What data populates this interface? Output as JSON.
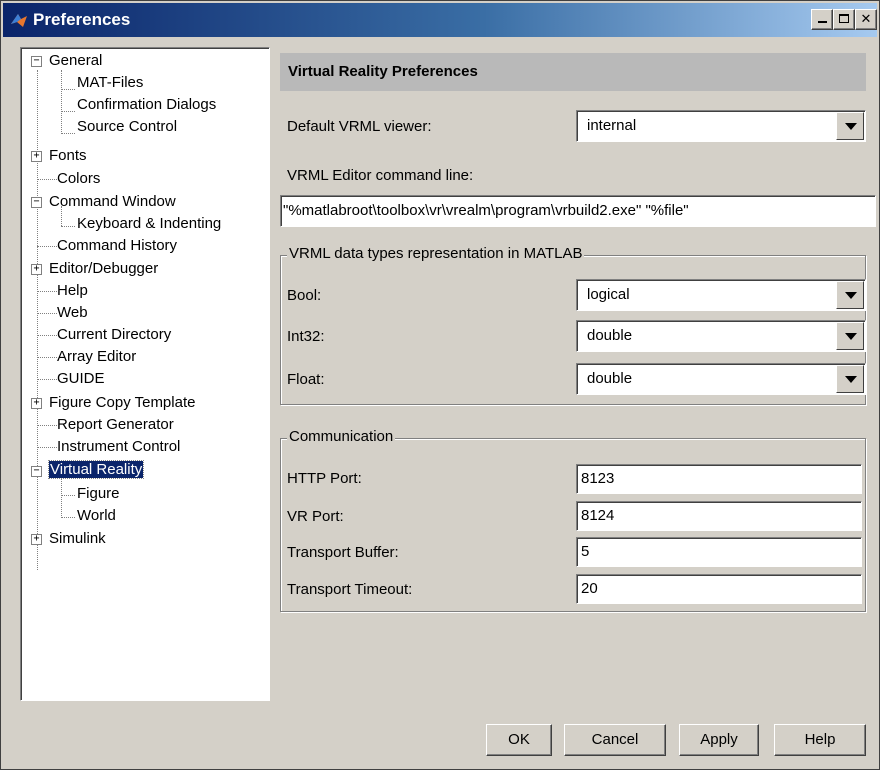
{
  "window": {
    "title": "Preferences"
  },
  "tree": {
    "items": [
      {
        "label": "General",
        "expander": "−"
      },
      {
        "label": "MAT-Files"
      },
      {
        "label": "Confirmation Dialogs"
      },
      {
        "label": "Source Control"
      },
      {
        "label": "Fonts",
        "expander": "+"
      },
      {
        "label": "Colors"
      },
      {
        "label": "Command Window",
        "expander": "−"
      },
      {
        "label": "Keyboard & Indenting"
      },
      {
        "label": "Command History"
      },
      {
        "label": "Editor/Debugger",
        "expander": "+"
      },
      {
        "label": "Help"
      },
      {
        "label": "Web"
      },
      {
        "label": "Current Directory"
      },
      {
        "label": "Array Editor"
      },
      {
        "label": "GUIDE"
      },
      {
        "label": "Figure Copy Template",
        "expander": "+"
      },
      {
        "label": "Report Generator"
      },
      {
        "label": "Instrument Control"
      },
      {
        "label": "Virtual Reality",
        "expander": "−",
        "selected": true
      },
      {
        "label": "Figure"
      },
      {
        "label": "World"
      },
      {
        "label": "Simulink",
        "expander": "+"
      }
    ]
  },
  "panel": {
    "header": "Virtual Reality Preferences",
    "viewer_label": "Default VRML viewer:",
    "viewer_value": "internal",
    "editor_label": "VRML Editor command line:",
    "editor_value": "\"%matlabroot\\toolbox\\vr\\vrealm\\program\\vrbuild2.exe\" \"%file\"",
    "types_group": {
      "title": "VRML data types representation in MATLAB",
      "bool_label": "Bool:",
      "bool_value": "logical",
      "int32_label": "Int32:",
      "int32_value": "double",
      "float_label": "Float:",
      "float_value": "double"
    },
    "comm_group": {
      "title": "Communication",
      "http_label": "HTTP Port:",
      "http_value": "8123",
      "vr_label": "VR Port:",
      "vr_value": "8124",
      "buffer_label": "Transport Buffer:",
      "buffer_value": "5",
      "timeout_label": "Transport Timeout:",
      "timeout_value": "20"
    }
  },
  "buttons": {
    "ok": "OK",
    "cancel": "Cancel",
    "apply": "Apply",
    "help": "Help"
  },
  "colors": {
    "titlebar": "#0a246a",
    "face": "#d4d0c8",
    "header": "#b9b9b9",
    "selection": "#0a246a"
  }
}
